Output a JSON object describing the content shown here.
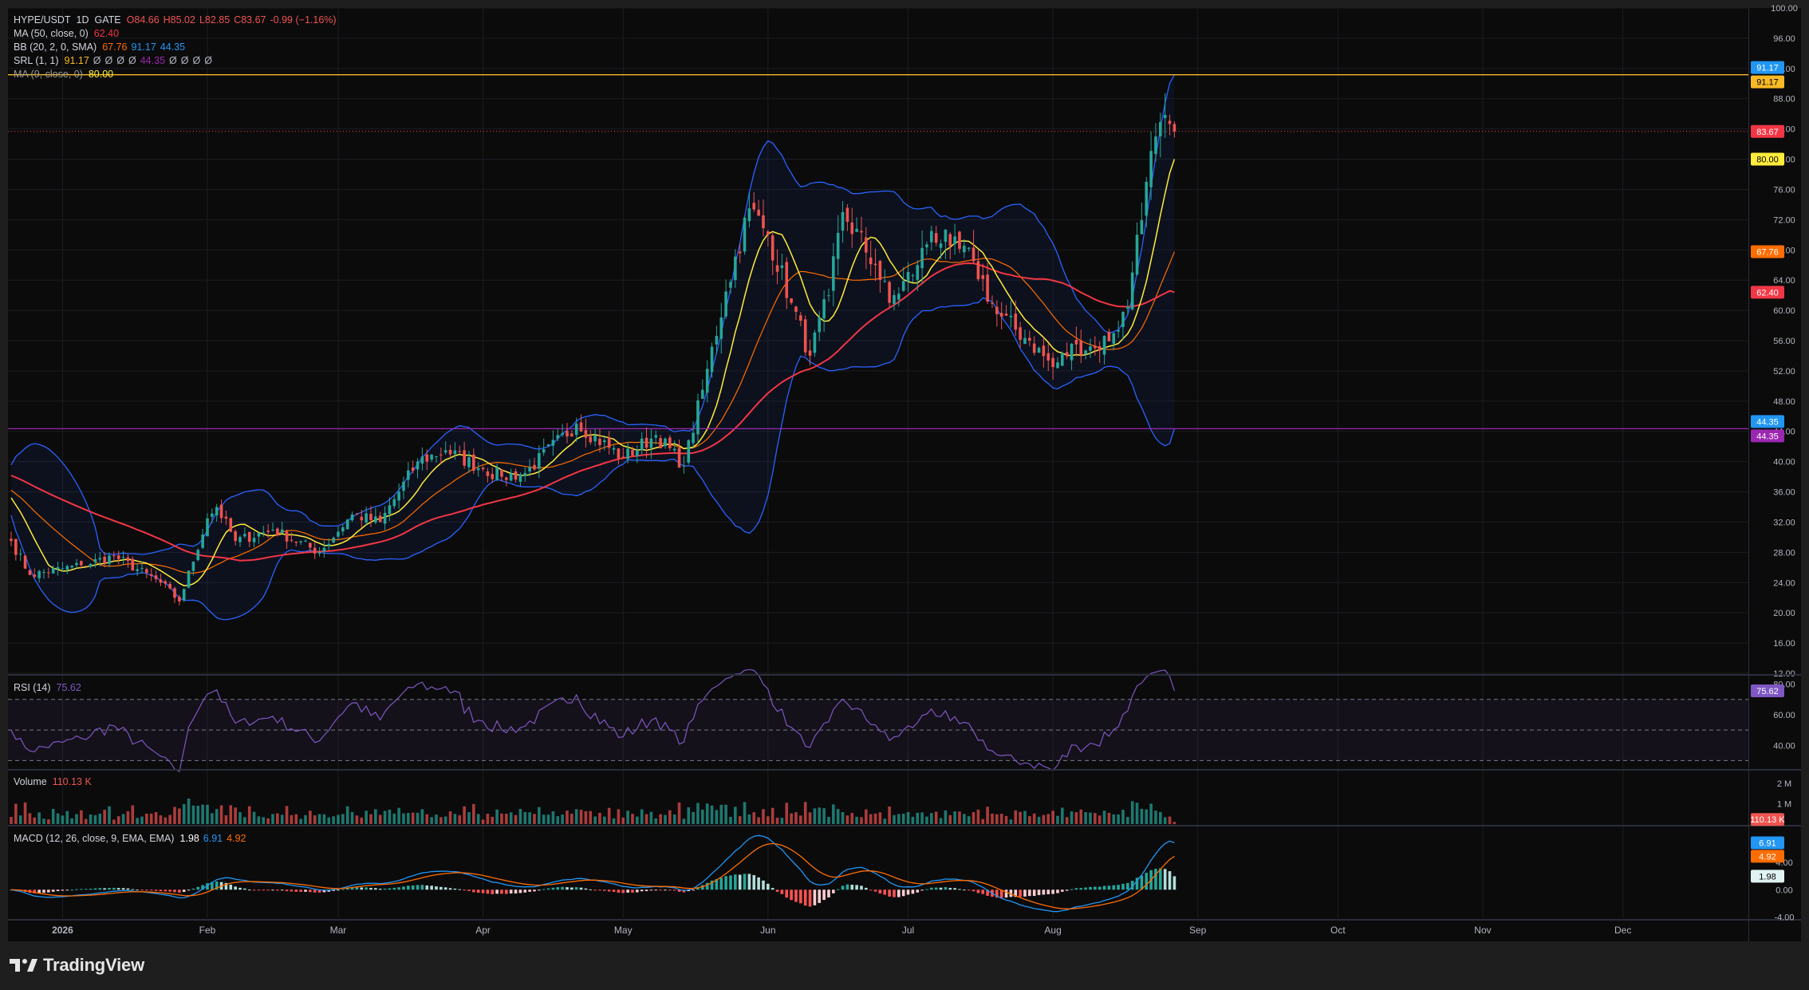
{
  "window": {
    "brand": "TradingView",
    "brand_icon": "tradingview-logo-icon"
  },
  "legend": {
    "symbol": "HYPE/USDT",
    "interval": "1D",
    "exchange": "GATE",
    "open": "O84.66",
    "high": "H85.02",
    "low": "L82.85",
    "close": "C83.67",
    "change": "-0.99 (−1.16%)",
    "ma50": {
      "label": "MA (50, close, 0)",
      "value": "62.40"
    },
    "bb": {
      "label": "BB (20, 2, 0, SMA)",
      "basis": "67.76",
      "upper": "91.17",
      "lower": "44.35"
    },
    "srl": {
      "label": "SRL (1, 1)",
      "v1": "91.17",
      "v2": "Ø",
      "v3": "Ø",
      "v4": "Ø",
      "v5": "Ø",
      "v6": "44.35",
      "v7": "Ø",
      "v8": "Ø",
      "v9": "Ø",
      "v10": "Ø"
    },
    "ma9": {
      "label": "MA (9, close, 0)",
      "value": "80.00"
    },
    "rsi": {
      "label": "RSI (14)",
      "value": "75.62"
    },
    "volume": {
      "label": "Volume",
      "value": "110.13 K"
    },
    "macd": {
      "label": "MACD (12, 26, close, 9, EMA, EMA)",
      "hist": "1.98",
      "macd": "6.91",
      "signal": "4.92"
    }
  },
  "colors": {
    "up": "#26a69a",
    "down": "#ef5350",
    "ma9": "#ffeb3b",
    "ma50": "#f23645",
    "bb_basis": "#ff6d00",
    "bb_band": "#2962ff",
    "rsi": "#7e57c2",
    "macd": "#2196f3",
    "signal": "#ff6d00",
    "srl_upper": "#f7b926",
    "srl_lower": "#9c27b0"
  },
  "chart_data": [
    {
      "type": "candlestick",
      "title": "HYPE/USDT · 1D · GATE",
      "ylim": [
        12,
        100
      ],
      "price_ticks": [
        "100.00",
        "96.00",
        "92.00",
        "88.00",
        "84.00",
        "80.00",
        "76.00",
        "72.00",
        "68.00",
        "64.00",
        "60.00",
        "56.00",
        "52.00",
        "48.00",
        "44.00",
        "40.00",
        "36.00",
        "32.00",
        "28.00",
        "24.00",
        "20.00",
        "16.00",
        "12.00"
      ],
      "x_labels": [
        "2026",
        "Feb",
        "Mar",
        "Apr",
        "May",
        "Jun",
        "Jul",
        "Aug",
        "Sep",
        "Oct",
        "Nov",
        "Dec"
      ],
      "close_anchors": [
        [
          "2025-12-21",
          29.5
        ],
        [
          "2025-12-25",
          25.0
        ],
        [
          "2026-01-05",
          26.3
        ],
        [
          "2026-01-12",
          27.5
        ],
        [
          "2026-01-22",
          24.0
        ],
        [
          "2026-01-26",
          21.5
        ],
        [
          "2026-02-01",
          32.5
        ],
        [
          "2026-02-03",
          34.0
        ],
        [
          "2026-02-07",
          29.5
        ],
        [
          "2026-02-15",
          31.0
        ],
        [
          "2026-02-25",
          28.0
        ],
        [
          "2026-03-04",
          33.0
        ],
        [
          "2026-03-10",
          32.0
        ],
        [
          "2026-03-18",
          40.0
        ],
        [
          "2026-03-24",
          41.5
        ],
        [
          "2026-04-01",
          39.0
        ],
        [
          "2026-04-05",
          38.0
        ],
        [
          "2026-04-10",
          38.5
        ],
        [
          "2026-04-21",
          45.0
        ],
        [
          "2026-05-01",
          40.5
        ],
        [
          "2026-05-08",
          43.5
        ],
        [
          "2026-05-14",
          39.5
        ],
        [
          "2026-05-18",
          49.5
        ],
        [
          "2026-05-23",
          62.5
        ],
        [
          "2026-05-28",
          73.5
        ],
        [
          "2026-06-01",
          70.0
        ],
        [
          "2026-06-06",
          61.0
        ],
        [
          "2026-06-10",
          54.0
        ],
        [
          "2026-06-14",
          62.0
        ],
        [
          "2026-06-17",
          73.0
        ],
        [
          "2026-06-24",
          66.0
        ],
        [
          "2026-06-27",
          61.0
        ],
        [
          "2026-07-03",
          66.0
        ],
        [
          "2026-07-06",
          70.5
        ],
        [
          "2026-07-10",
          68.5
        ],
        [
          "2026-07-15",
          66.5
        ],
        [
          "2026-07-20",
          59.5
        ],
        [
          "2026-07-27",
          56.0
        ],
        [
          "2026-08-01",
          52.5
        ],
        [
          "2026-08-06",
          55.5
        ],
        [
          "2026-08-10",
          55.0
        ],
        [
          "2026-08-14",
          57.0
        ],
        [
          "2026-08-17",
          60.5
        ],
        [
          "2026-08-19",
          70.0
        ],
        [
          "2026-08-21",
          77.0
        ],
        [
          "2026-08-23",
          83.0
        ],
        [
          "2026-08-26",
          84.66
        ],
        [
          "2026-08-27",
          83.67
        ]
      ],
      "last_candle": {
        "open": 84.66,
        "high": 85.02,
        "low": 82.85,
        "close": 83.67
      },
      "overlays": {
        "ma9": 80.0,
        "ma50": 62.4,
        "bb_basis": 67.76,
        "bb_upper": 91.17,
        "bb_lower": 44.35
      },
      "horizontal_lines": [
        {
          "name": "srl-upper",
          "value": 91.17
        },
        {
          "name": "srl-lower",
          "value": 44.35
        }
      ],
      "price_labels": [
        {
          "text": "91.17",
          "value": 91.17,
          "color": "#2196f3",
          "text_color": "#ffffff",
          "side": "above"
        },
        {
          "text": "91.17",
          "value": 91.17,
          "color": "#f7b926",
          "text_color": "#000000",
          "side": "below"
        },
        {
          "text": "83.67",
          "value": 83.67,
          "color": "#f23645",
          "text_color": "#ffffff",
          "side": "center"
        },
        {
          "text": "80.00",
          "value": 80.0,
          "color": "#ffeb3b",
          "text_color": "#000000",
          "side": "center"
        },
        {
          "text": "67.76",
          "value": 67.76,
          "color": "#ff6d00",
          "text_color": "#ffffff",
          "side": "center"
        },
        {
          "text": "62.40",
          "value": 62.4,
          "color": "#f23645",
          "text_color": "#ffffff",
          "side": "center"
        },
        {
          "text": "44.35",
          "value": 44.35,
          "color": "#2196f3",
          "text_color": "#ffffff",
          "side": "above"
        },
        {
          "text": "44.35",
          "value": 44.35,
          "color": "#9c27b0",
          "text_color": "#ffffff",
          "side": "below"
        }
      ]
    },
    {
      "type": "line",
      "name": "RSI (14)",
      "ylim": [
        25,
        85
      ],
      "bands": [
        30,
        50,
        70
      ],
      "ticks": [
        "80.00",
        "60.00",
        "40.00"
      ],
      "last": 75.62,
      "label": "75.62"
    },
    {
      "type": "bar",
      "name": "Volume",
      "ylim": [
        0,
        2600000
      ],
      "ticks": [
        "2 M",
        "1 M"
      ],
      "last": 110130,
      "label": "110.13 K"
    },
    {
      "type": "line",
      "name": "MACD (12, 26, close, 9, EMA, EMA)",
      "ylim": [
        -4.2,
        9.2
      ],
      "ticks": [
        "4.00",
        "0.00",
        "-4.00"
      ],
      "last_macd": 6.91,
      "last_signal": 4.92,
      "last_hist": 1.98,
      "labels": {
        "macd": "6.91",
        "signal": "4.92",
        "hist": "1.98"
      }
    }
  ]
}
